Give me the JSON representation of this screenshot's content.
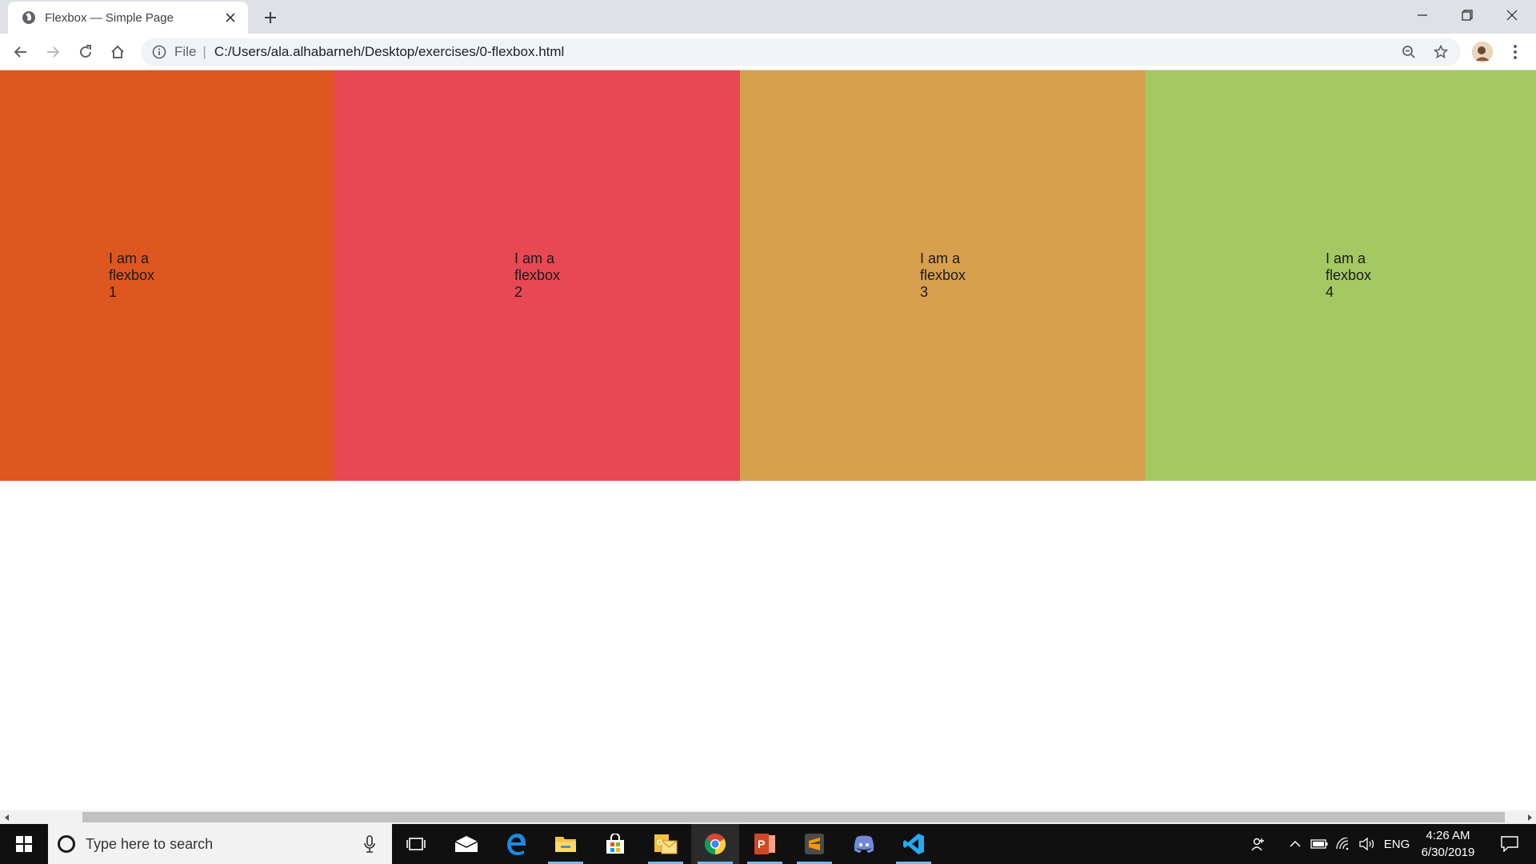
{
  "browser": {
    "tab_title": "Flexbox — Simple Page",
    "url_scheme": "File",
    "url": "C:/Users/ala.alhabarneh/Desktop/exercises/0-flexbox.html"
  },
  "page": {
    "boxes": [
      {
        "line1": "I am a",
        "line2": "flexbox",
        "line3": "1",
        "color": "#de5620"
      },
      {
        "line1": "I am a",
        "line2": "flexbox",
        "line3": "2",
        "color": "#e84853"
      },
      {
        "line1": "I am a",
        "line2": "flexbox",
        "line3": "3",
        "color": "#d6a04f"
      },
      {
        "line1": "I am a",
        "line2": "flexbox",
        "line3": "4",
        "color": "#a4c963"
      }
    ]
  },
  "taskbar": {
    "search_placeholder": "Type here to search",
    "language": "ENG",
    "time": "4:26 AM",
    "date": "6/30/2019"
  }
}
